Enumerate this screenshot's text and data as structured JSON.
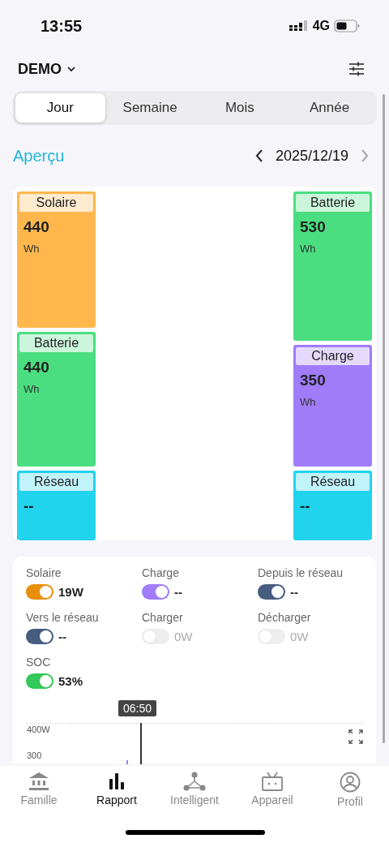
{
  "status_bar": {
    "time": "13:55",
    "network": "4G"
  },
  "header": {
    "site": "DEMO"
  },
  "tabs": [
    {
      "label": "Jour",
      "selected": true
    },
    {
      "label": "Semaine",
      "selected": false
    },
    {
      "label": "Mois",
      "selected": false
    },
    {
      "label": "Année",
      "selected": false
    }
  ],
  "overview": {
    "title": "Aperçu",
    "date": "2025/12/19"
  },
  "flows": {
    "left": [
      {
        "label": "Solaire",
        "value": "440",
        "unit": "Wh",
        "color": "#ffb74d"
      },
      {
        "label": "Batterie",
        "value": "440",
        "unit": "Wh",
        "color": "#4ade80"
      },
      {
        "label": "Réseau",
        "value": "--",
        "color": "#22d3ee"
      }
    ],
    "right": [
      {
        "label": "Batterie",
        "value": "530",
        "unit": "Wh",
        "color": "#4ade80"
      },
      {
        "label": "Charge",
        "value": "350",
        "unit": "Wh",
        "color": "#a07cfb"
      },
      {
        "label": "Réseau",
        "value": "--",
        "color": "#22d3ee"
      }
    ]
  },
  "legend": [
    {
      "label": "Solaire",
      "value": "19W",
      "on": true,
      "color": "#e8900c"
    },
    {
      "label": "Charge",
      "value": "--",
      "on": true,
      "color": "#a07cfb"
    },
    {
      "label": "Depuis le réseau",
      "value": "--",
      "on": true,
      "color": "#475d80"
    },
    {
      "label": "Vers le réseau",
      "value": "--",
      "on": true,
      "color": "#475d80"
    },
    {
      "label": "Charger",
      "value": "0W",
      "on": false
    },
    {
      "label": "Décharger",
      "value": "0W",
      "on": false
    },
    {
      "label": "SOC",
      "value": "53%",
      "on": true,
      "color": "#34c759"
    }
  ],
  "chart": {
    "cursor_time": "06:50",
    "y_labels": [
      "400W",
      "300"
    ]
  },
  "nav": [
    {
      "label": "Famille",
      "selected": false
    },
    {
      "label": "Rapport",
      "selected": true
    },
    {
      "label": "Intelligent",
      "selected": false
    },
    {
      "label": "Appareil",
      "selected": false
    },
    {
      "label": "Profil",
      "selected": false
    }
  ]
}
